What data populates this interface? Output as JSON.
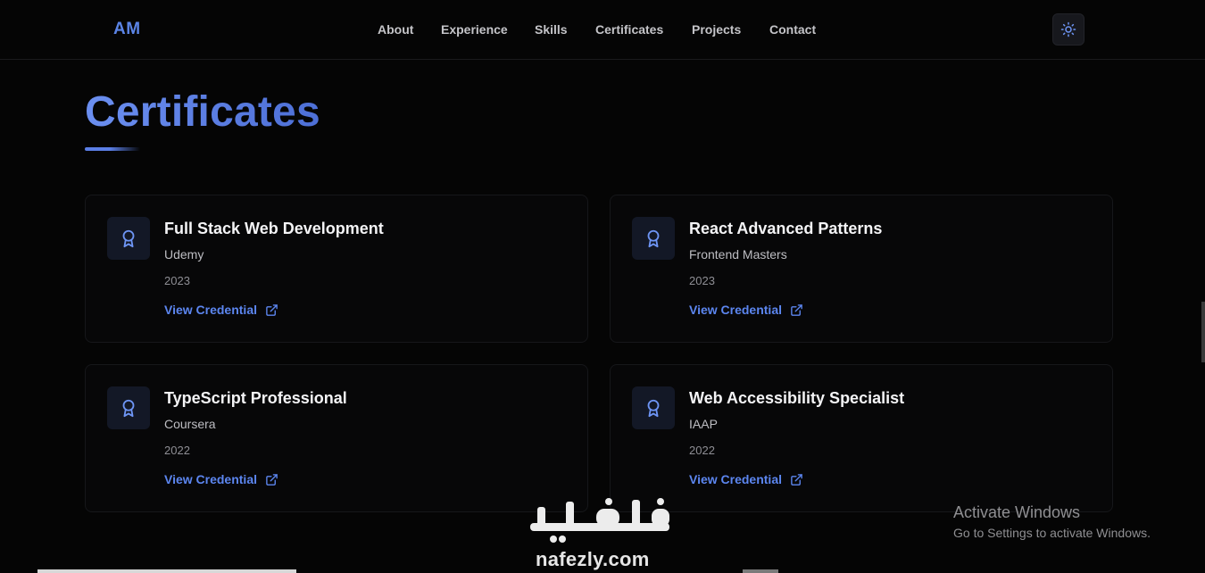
{
  "navbar": {
    "logo": "AM",
    "links": [
      "About",
      "Experience",
      "Skills",
      "Certificates",
      "Projects",
      "Contact"
    ],
    "theme_icon": "sun-icon"
  },
  "section": {
    "title": "Certificates"
  },
  "certificates": [
    {
      "title": "Full Stack Web Development",
      "issuer": "Udemy",
      "year": "2023",
      "link_label": "View Credential"
    },
    {
      "title": "React Advanced Patterns",
      "issuer": "Frontend Masters",
      "year": "2023",
      "link_label": "View Credential"
    },
    {
      "title": "TypeScript Professional",
      "issuer": "Coursera",
      "year": "2022",
      "link_label": "View Credential"
    },
    {
      "title": "Web Accessibility Specialist",
      "issuer": "IAAP",
      "year": "2022",
      "link_label": "View Credential"
    }
  ],
  "watermarks": {
    "activate_title": "Activate Windows",
    "activate_subtitle": "Go to Settings to activate Windows.",
    "nafezly_url": "nafezly.com"
  },
  "colors": {
    "accent": "#5c86f0",
    "background": "#050505",
    "card_bg": "#070708",
    "icon_bg": "#131826"
  },
  "icons": {
    "certificate": "award-ribbon-icon",
    "external_link": "external-link-icon"
  }
}
